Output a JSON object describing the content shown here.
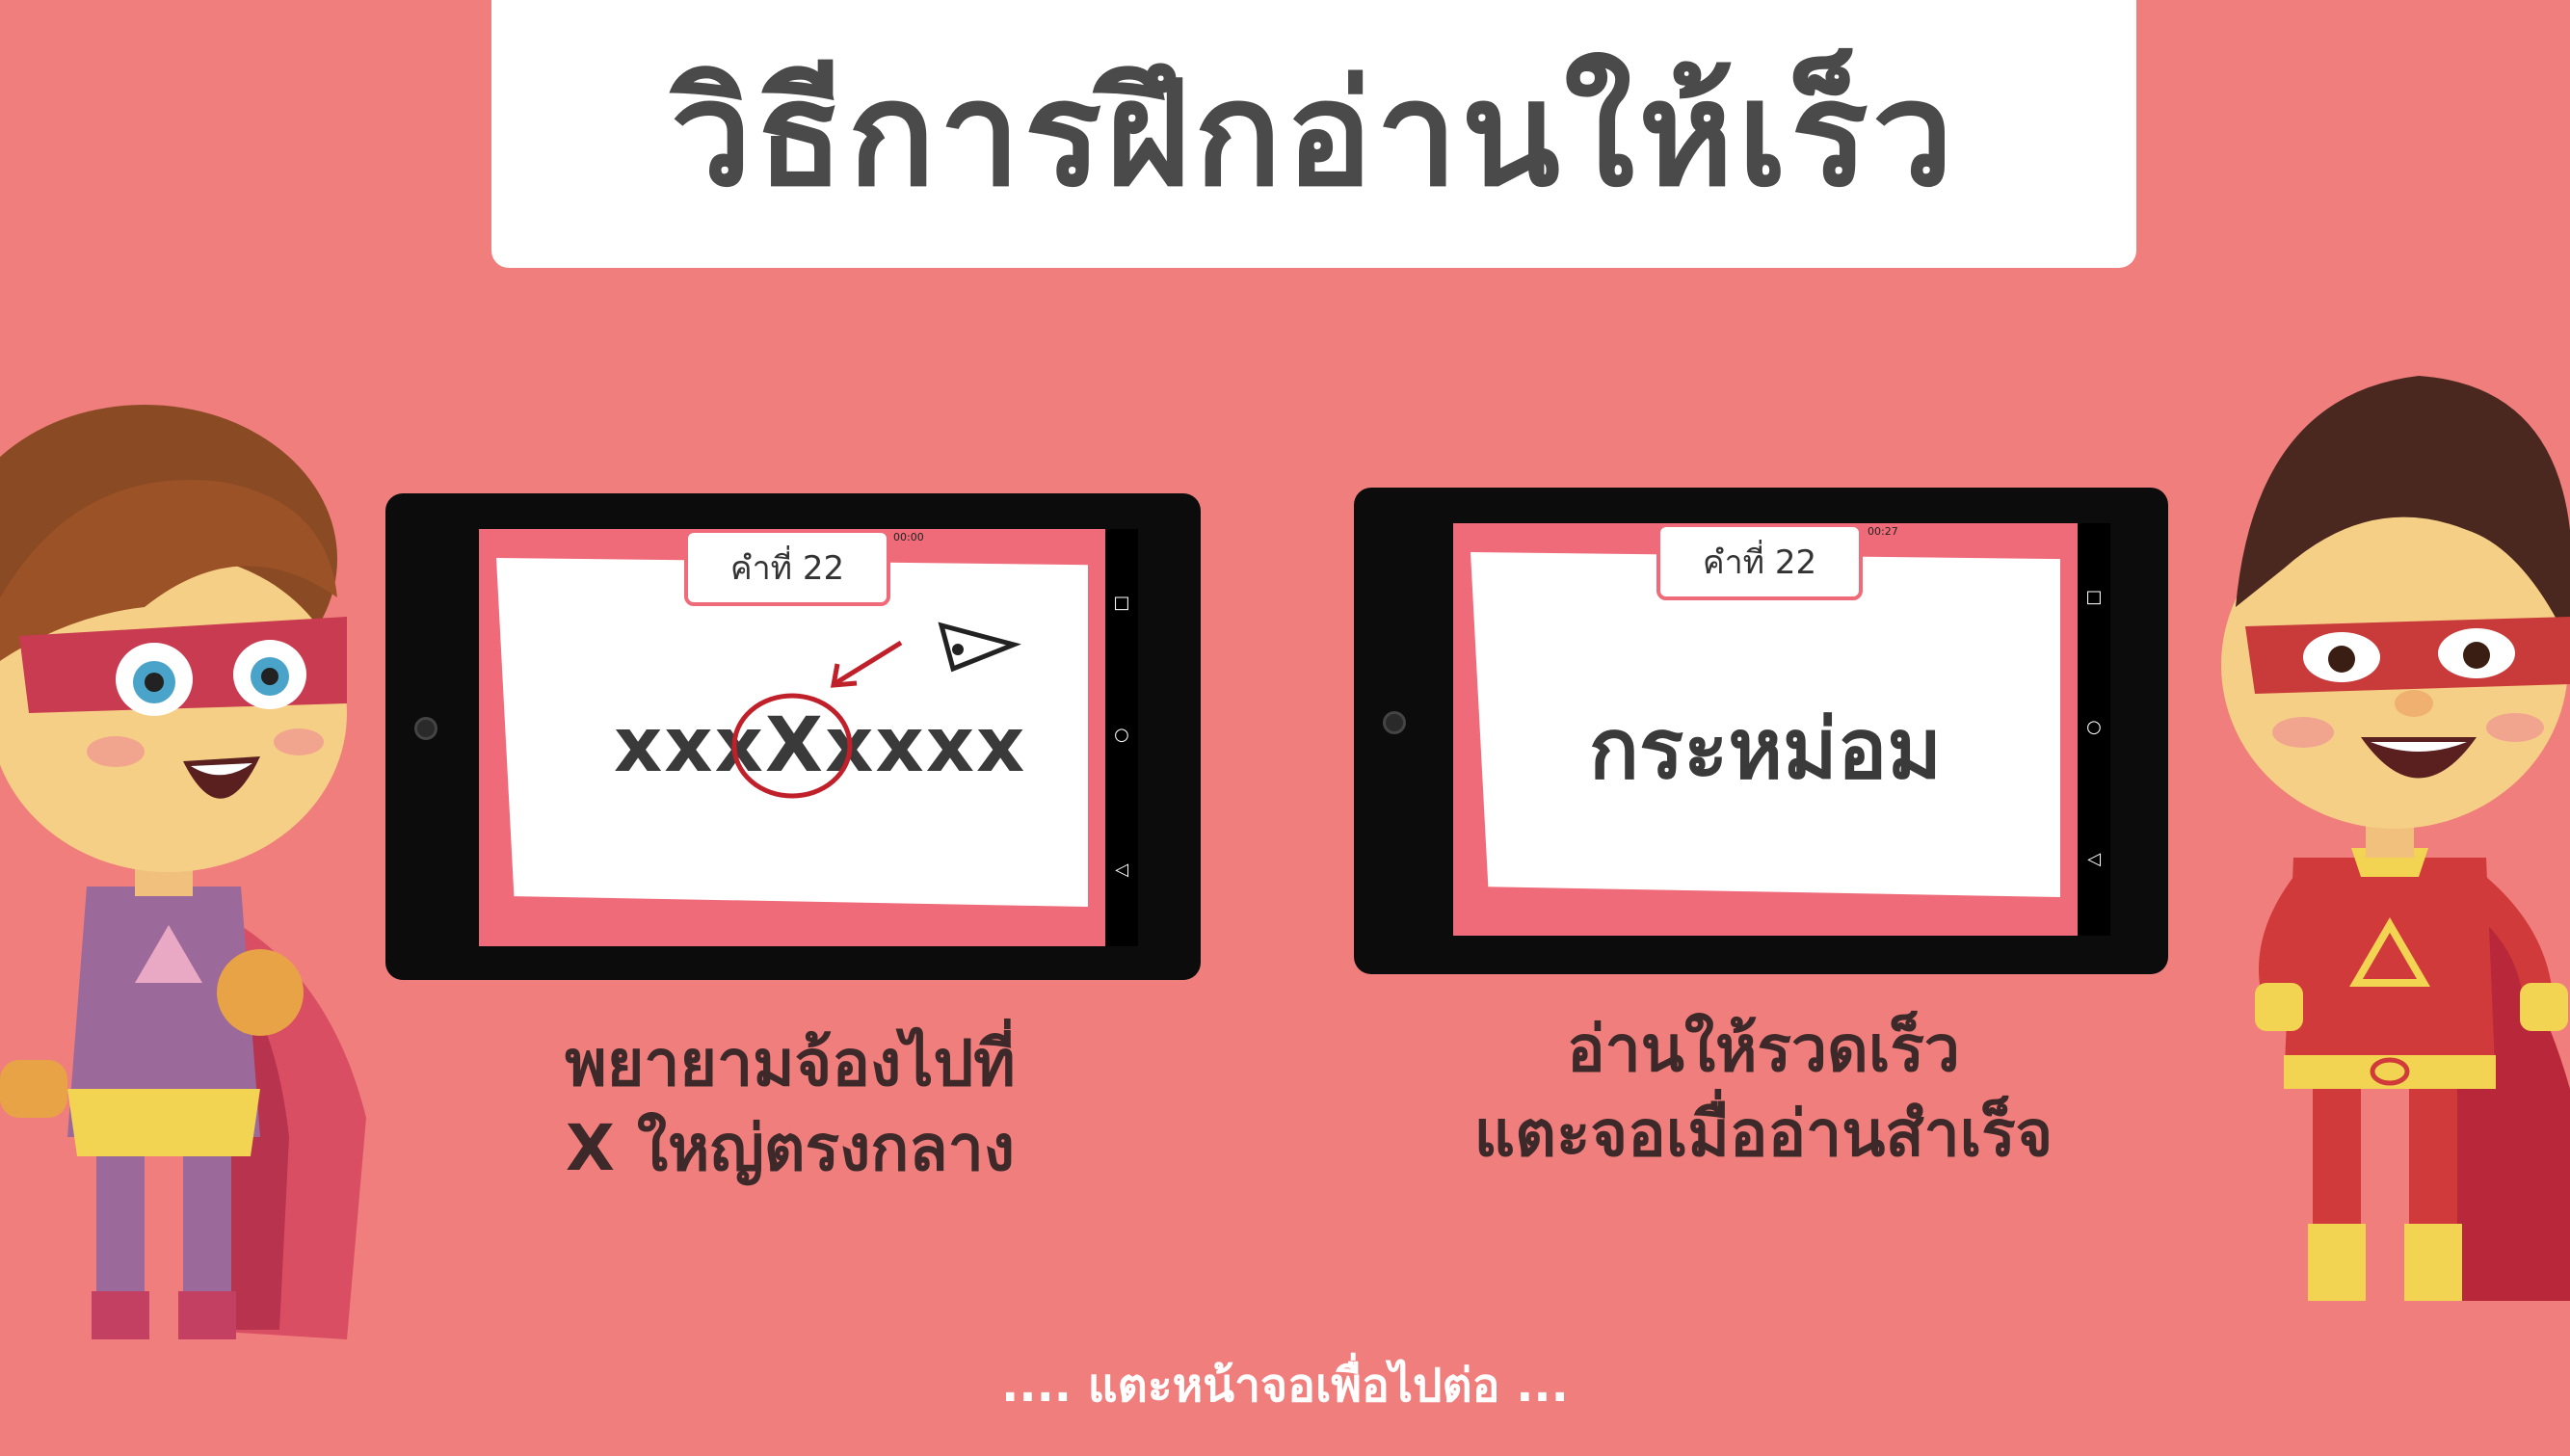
{
  "title": "วิธีการฝึกอ่านให้เร็ว",
  "left_panel": {
    "word_tag": "คำที่ 22",
    "clock": "00:00",
    "demo_text": "xxxXxxxx",
    "caption_line1": "พยายามจ้องไปที่",
    "caption_line2": "X ใหญ่ตรงกลาง"
  },
  "right_panel": {
    "word_tag": "คำที่ 22",
    "clock": "00:27",
    "word": "กระหม่อม",
    "caption_line1": "อ่านให้รวดเร็ว",
    "caption_line2": "แตะจอเมื่ออ่านสำเร็จ"
  },
  "nav_icons": [
    "square-icon",
    "circle-icon",
    "triangle-back-icon"
  ],
  "footer_hint": ".... แตะหน้าจอเพื่อไปต่อ ...",
  "colors": {
    "background": "#ef7e7c",
    "accent_pink": "#ef6b79",
    "marker_red": "#c0202a",
    "text_dark": "#4a4a4a"
  }
}
